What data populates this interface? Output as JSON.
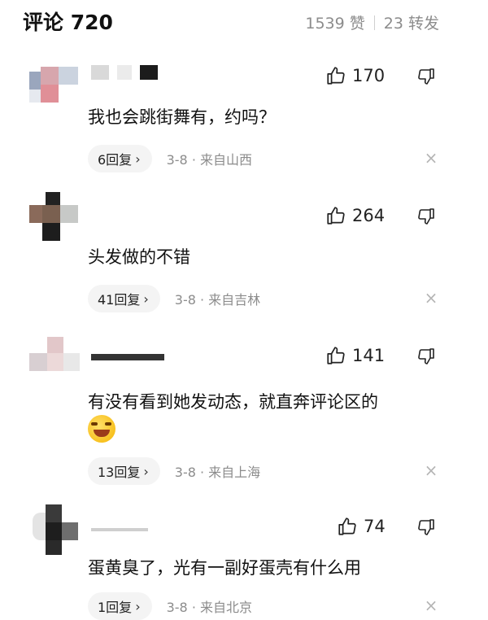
{
  "header": {
    "title": "评论 720",
    "likes": "1539 赞",
    "reposts": "23 转发"
  },
  "icons": {
    "like": "thumbs-up-icon",
    "dislike": "thumbs-down-icon",
    "close": "close-icon",
    "chevron": "chevron-right-icon"
  },
  "comments": [
    {
      "username": "",
      "likes": "170",
      "text": "我也会跳街舞有，约吗？",
      "replies": "6回复",
      "chevron": "›",
      "meta": "3-8 · 来自山西",
      "close": "×"
    },
    {
      "username": "",
      "likes": "264",
      "text": "头发做的不错",
      "replies": "41回复",
      "chevron": "›",
      "meta": "3-8 · 来自吉林",
      "close": "×"
    },
    {
      "username": "",
      "likes": "141",
      "text": "有没有看到她发动态，就直奔评论区的",
      "replies": "13回复",
      "chevron": "›",
      "meta": "3-8 · 来自上海",
      "close": "×"
    },
    {
      "username": "",
      "likes": "74",
      "text": "蛋黄臭了，光有一副好蛋壳有什么用",
      "replies": "1回复",
      "chevron": "›",
      "meta": "3-8 · 来自北京",
      "close": "×"
    }
  ]
}
